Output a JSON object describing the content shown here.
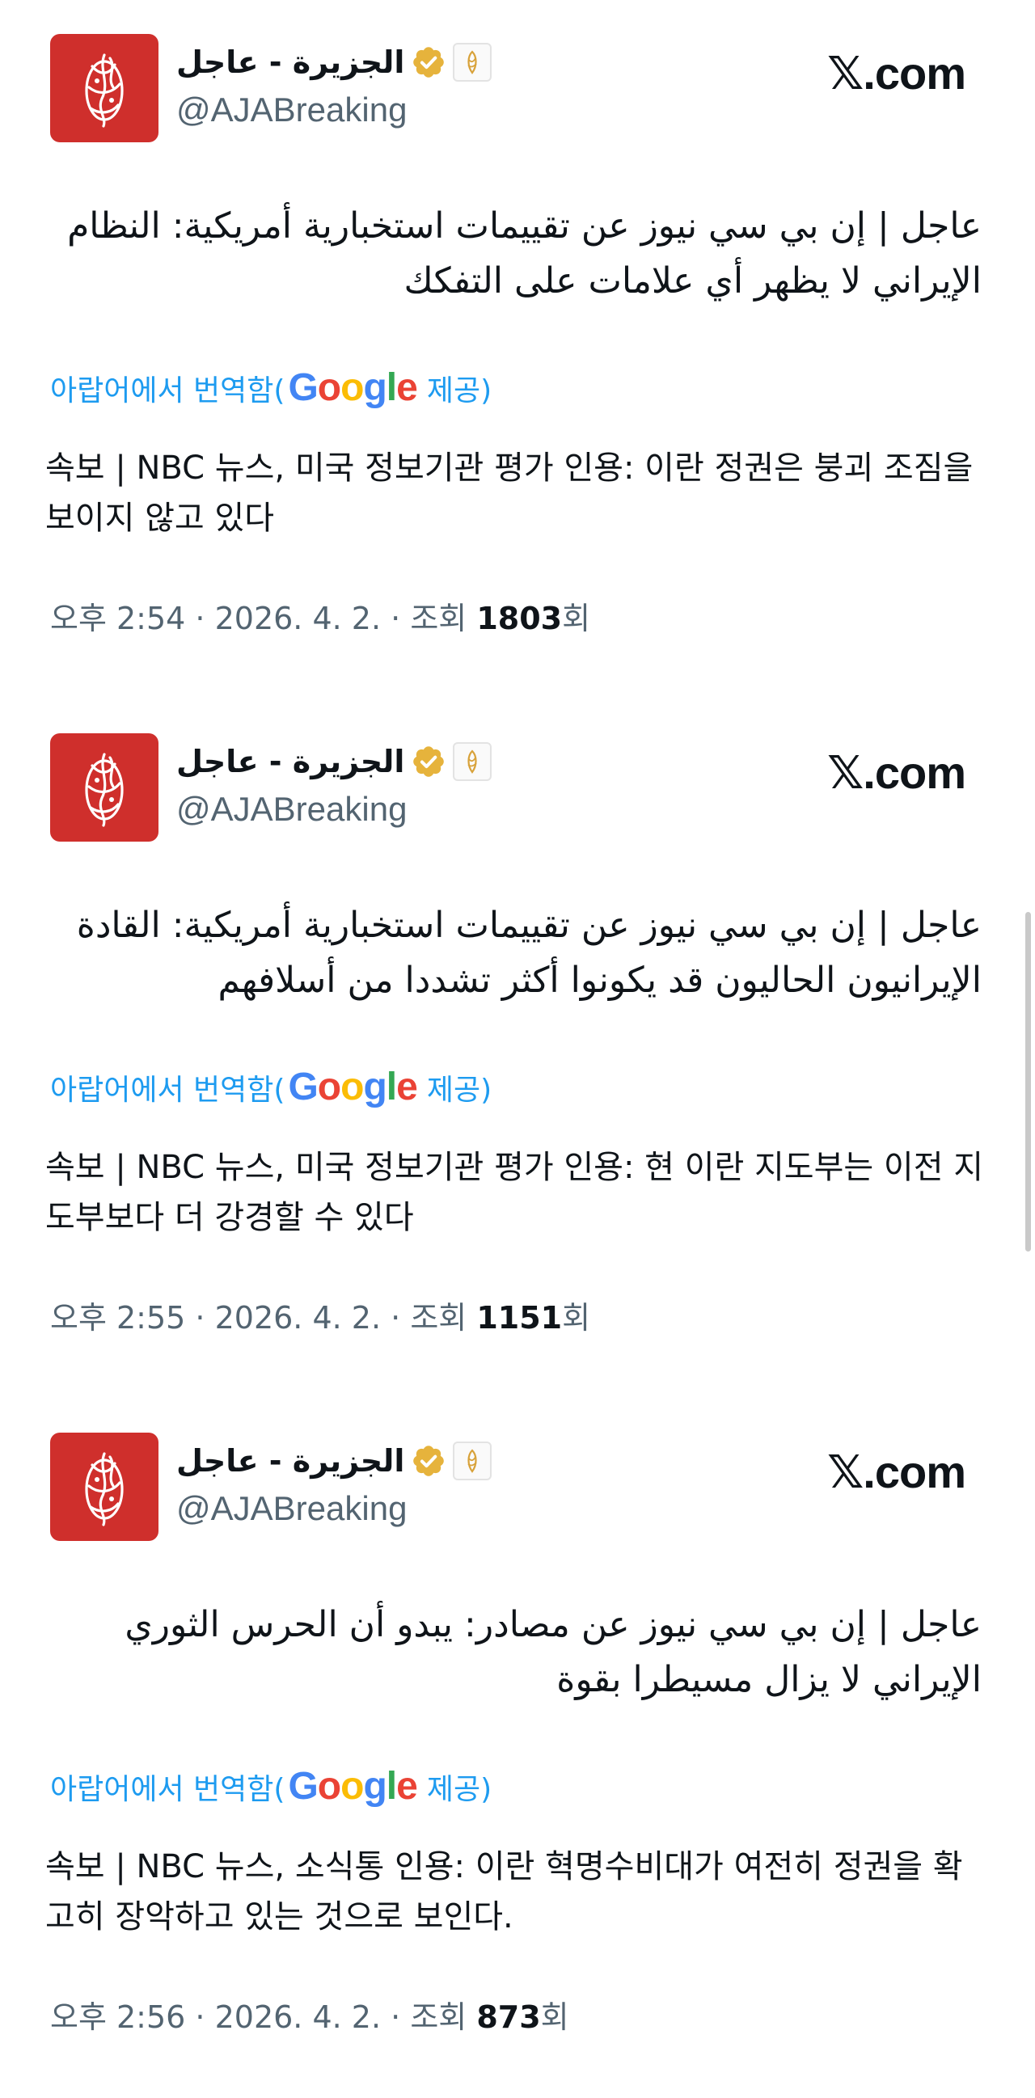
{
  "colors": {
    "brand_red": "#cf2f2c",
    "verified_gold": "#e6b33c",
    "link_blue": "#1d9bf0",
    "secondary_text": "#536471"
  },
  "tweets": [
    {
      "display_name": "الجزيرة - عاجل",
      "handle": "@AJABreaking",
      "site": ".com",
      "original_text": "عاجل | إن بي سي نيوز عن تقييمات استخبارية أمريكية: النظام الإيراني لا يظهر أي علامات على التفكك",
      "translated_prefix": "아랍어에서 번역함(",
      "translated_suffix": "제공)",
      "translation": "속보 | NBC 뉴스, 미국 정보기관 평가 인용: 이란 정권은 붕괴 조짐을 보이지 않고 있다",
      "time": "오후 2:54",
      "date": "2026. 4. 2.",
      "views_label": "조회",
      "views": "1803",
      "views_unit": "회"
    },
    {
      "display_name": "الجزيرة - عاجل",
      "handle": "@AJABreaking",
      "site": ".com",
      "original_text": "عاجل | إن بي سي نيوز عن تقييمات استخبارية أمريكية: القادة الإيرانيون الحاليون قد يكونوا أكثر تشددا من أسلافهم",
      "translated_prefix": "아랍어에서 번역함(",
      "translated_suffix": "제공)",
      "translation": "속보 | NBC 뉴스, 미국 정보기관 평가 인용: 현 이란 지도부는 이전 지도부보다 더 강경할 수 있다",
      "time": "오후 2:55",
      "date": "2026. 4. 2.",
      "views_label": "조회",
      "views": "1151",
      "views_unit": "회"
    },
    {
      "display_name": "الجزيرة - عاجل",
      "handle": "@AJABreaking",
      "site": ".com",
      "original_text": "عاجل | إن بي سي نيوز عن مصادر: يبدو أن الحرس الثوري الإيراني لا يزال مسيطرا بقوة",
      "translated_prefix": "아랍어에서 번역함(",
      "translated_suffix": "제공)",
      "translation": "속보 | NBC 뉴스, 소식통 인용: 이란 혁명수비대가 여전히 정권을 확고히 장악하고 있는 것으로 보인다.",
      "time": "오후 2:56",
      "date": "2026. 4. 2.",
      "views_label": "조회",
      "views": "873",
      "views_unit": "회"
    }
  ]
}
